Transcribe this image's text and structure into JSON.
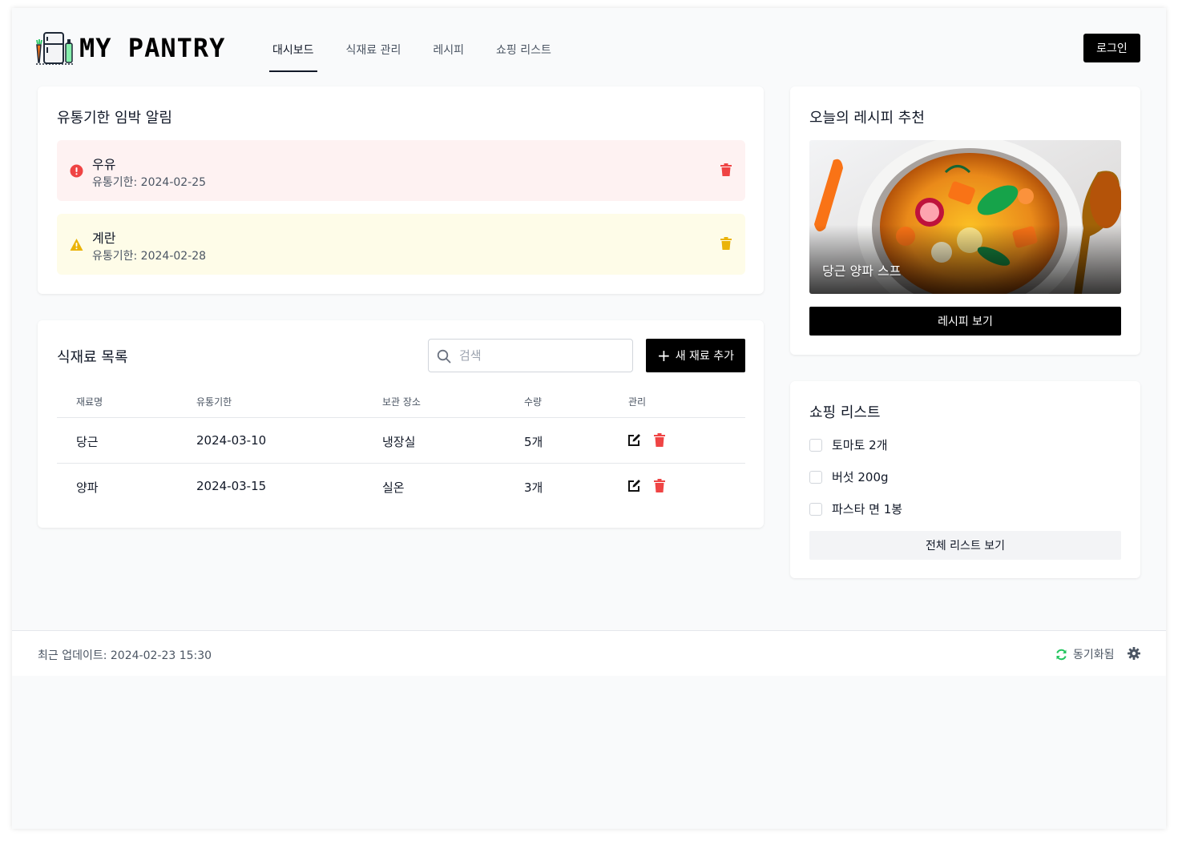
{
  "header": {
    "logo_text": "MY PANTRY",
    "nav": [
      {
        "label": "대시보드",
        "active": true
      },
      {
        "label": "식재료 관리",
        "active": false
      },
      {
        "label": "레시피",
        "active": false
      },
      {
        "label": "쇼핑 리스트",
        "active": false
      }
    ],
    "login_label": "로그인"
  },
  "alerts": {
    "title": "유통기한 임박 알림",
    "items": [
      {
        "name": "우유",
        "date": "유통기한: 2024-02-25",
        "level": "danger",
        "icon": "exclamation-circle-icon"
      },
      {
        "name": "계란",
        "date": "유통기한: 2024-02-28",
        "level": "warning",
        "icon": "warning-triangle-icon"
      }
    ]
  },
  "ingredients": {
    "title": "식재료 목록",
    "search_placeholder": "검색",
    "add_label": "새 재료 추가",
    "columns": [
      "재료명",
      "유통기한",
      "보관 장소",
      "수량",
      "관리"
    ],
    "rows": [
      {
        "name": "당근",
        "expiry": "2024-03-10",
        "storage": "냉장실",
        "qty": "5개"
      },
      {
        "name": "양파",
        "expiry": "2024-03-15",
        "storage": "실온",
        "qty": "3개"
      }
    ]
  },
  "recipe": {
    "title": "오늘의 레시피 추천",
    "name": "당근 양파 스프",
    "button": "레시피 보기"
  },
  "shopping": {
    "title": "쇼핑 리스트",
    "items": [
      {
        "label": "토마토 2개",
        "checked": false
      },
      {
        "label": "버섯 200g",
        "checked": false
      },
      {
        "label": "파스타 면 1봉",
        "checked": false
      }
    ],
    "view_all": "전체 리스트 보기"
  },
  "footer": {
    "updated": "최근 업데이트: 2024-02-23 15:30",
    "sync_status": "동기화됨"
  },
  "colors": {
    "danger_bg": "#fef2f2",
    "danger": "#ef4444",
    "warning_bg": "#fefce8",
    "warning": "#eab308",
    "sync": "#22c55e",
    "primary": "#000000"
  }
}
